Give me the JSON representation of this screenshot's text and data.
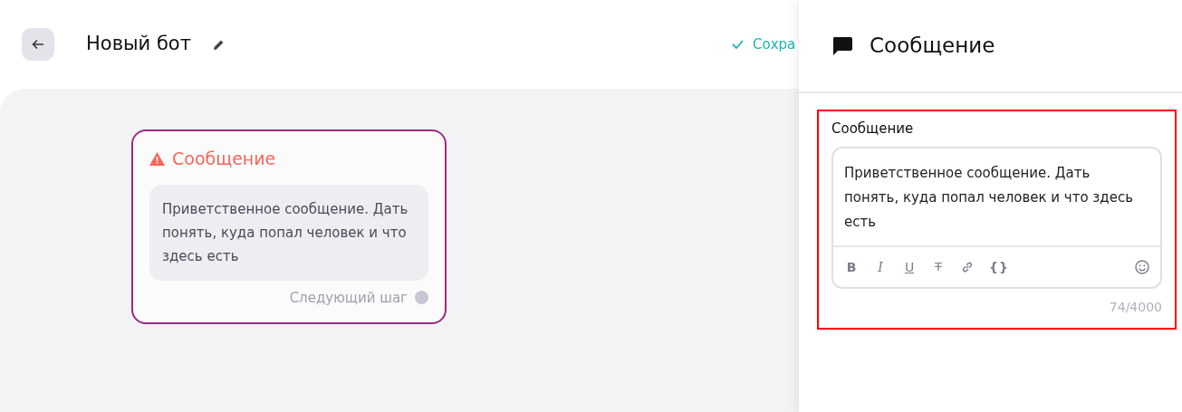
{
  "header": {
    "title": "Новый бот",
    "save_label": "Сохра"
  },
  "node": {
    "title": "Сообщение",
    "warning": true,
    "selected": true,
    "text": "Приветственное сообщение. Дать понять, куда попал человек и что здесь есть",
    "next_label": "Следующий шаг",
    "next_connected": false
  },
  "panel": {
    "title": "Сообщение",
    "field_label": "Сообщение",
    "highlighted": true,
    "value": "Приветственное сообщение. Дать понять, куда попал человек и что здесь есть",
    "toolbar": [
      {
        "kind": "bold",
        "label": "B"
      },
      {
        "kind": "italic",
        "label": "I"
      },
      {
        "kind": "underline",
        "label": "U"
      },
      {
        "kind": "strike",
        "label": "T"
      },
      {
        "kind": "link"
      },
      {
        "kind": "code",
        "label": "{}"
      }
    ],
    "counter": "74/4000"
  }
}
